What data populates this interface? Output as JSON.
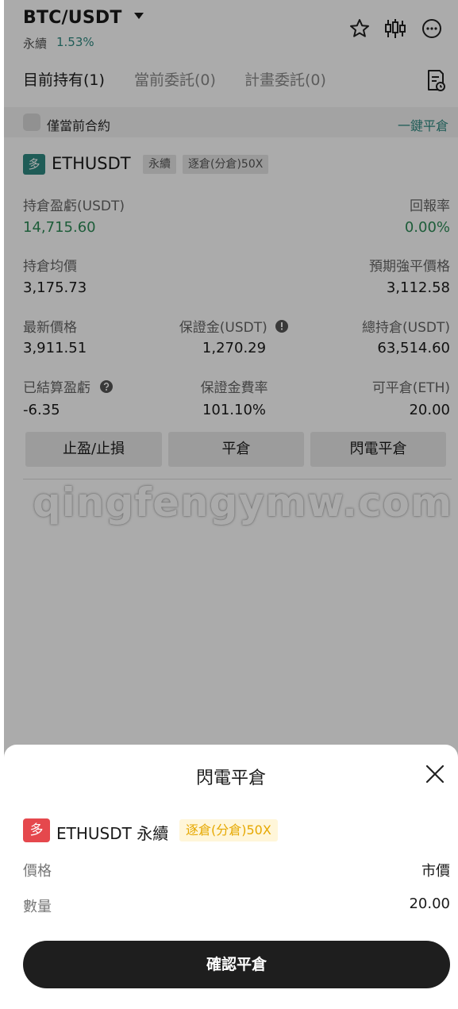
{
  "header": {
    "pair": "BTC/USDT",
    "type": "永續",
    "change": "1.53%"
  },
  "tabs": [
    {
      "label": "目前持有(1)"
    },
    {
      "label": "當前委託(0)"
    },
    {
      "label": "計畫委託(0)"
    }
  ],
  "filter": {
    "checkbox_label": "僅當前合約",
    "one_key_close": "一鍵平倉"
  },
  "position": {
    "side_badge": "多",
    "symbol": "ETHUSDT",
    "contract_type": "永續",
    "margin_mode": "逐倉(分倉)50X",
    "fields": {
      "pnl_label": "持倉盈虧(USDT)",
      "pnl_value": "14,715.60",
      "roe_label": "回報率",
      "roe_value": "0.00%",
      "avg_label": "持倉均價",
      "avg_value": "3,175.73",
      "liq_label": "預期強平價格",
      "liq_value": "3,112.58",
      "last_label": "最新價格",
      "last_value": "3,911.51",
      "margin_label": "保證金(USDT)",
      "margin_value": "1,270.29",
      "total_label": "總持倉(USDT)",
      "total_value": "63,514.60",
      "realized_label": "已結算盈虧",
      "realized_value": "-6.35",
      "margin_rate_label": "保證金費率",
      "margin_rate_value": "101.10%",
      "closable_label": "可平倉(ETH)",
      "closable_value": "20.00"
    },
    "buttons": {
      "tpsl": "止盈/止損",
      "close": "平倉",
      "flash_close": "閃電平倉"
    }
  },
  "watermark": "qingfengymw.com",
  "sheet": {
    "title": "閃電平倉",
    "side_badge": "多",
    "symbol": "ETHUSDT 永續",
    "margin_mode": "逐倉(分倉)50X",
    "price_label": "價格",
    "price_value": "市價",
    "qty_label": "數量",
    "qty_value": "20.00",
    "confirm": "確認平倉"
  },
  "colors": {
    "accent_teal": "#2f8a82",
    "profit_green": "#2e8b57",
    "badge_red": "#e5484d",
    "chip_orange": "#e6a800",
    "confirm_bg": "#1e1e1e"
  }
}
